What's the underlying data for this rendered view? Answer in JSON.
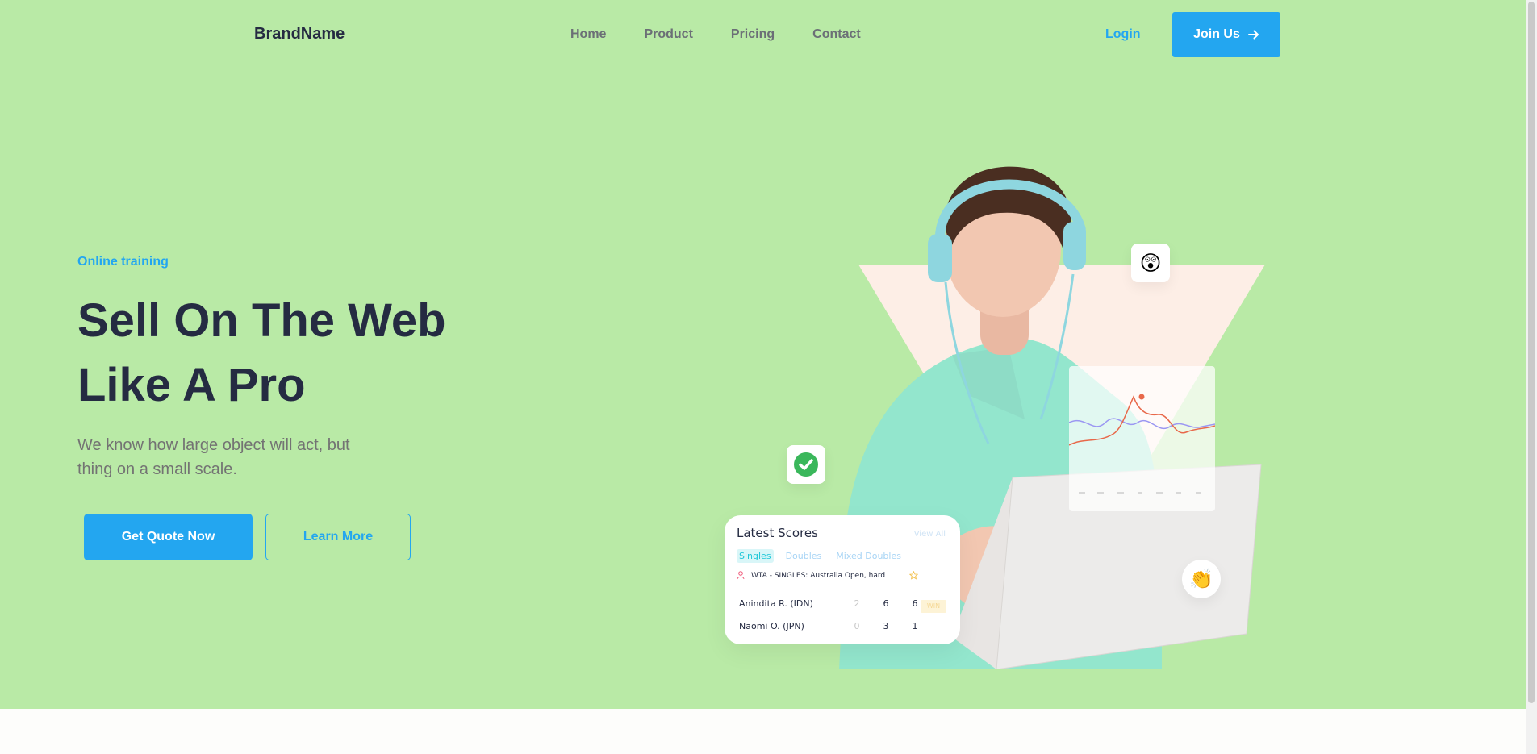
{
  "nav": {
    "brand": "BrandName",
    "links": [
      "Home",
      "Product",
      "Pricing",
      "Contact"
    ],
    "login": "Login",
    "join": "Join Us"
  },
  "hero": {
    "eyebrow": "Online training",
    "headline_line1": "Sell On The Web",
    "headline_line2": "Like A Pro",
    "subtext_line1": "We know how large object will act, but",
    "subtext_line2": "thing on a small scale.",
    "primary_button": "Get Quote Now",
    "secondary_button": "Learn More"
  },
  "scores_card": {
    "title": "Latest Scores",
    "view_all": "View All",
    "tabs": [
      "Singles",
      "Doubles",
      "Mixed Doubles"
    ],
    "event": "WTA - SINGLES: Australia Open, hard",
    "rows": [
      {
        "name": "Anindita R. (IDN)",
        "scores": [
          "2",
          "6",
          "6"
        ],
        "badge": "WIN"
      },
      {
        "name": "Naomi O. (JPN)",
        "scores": [
          "0",
          "3",
          "1"
        ]
      }
    ]
  },
  "colors": {
    "hero_bg": "#b9eaa6",
    "accent": "#23a6f0",
    "heading": "#252b42",
    "muted": "#737373"
  },
  "icons": {
    "emoji_shocked": "😲",
    "emoji_clap": "👏",
    "check": "check-circle-icon"
  }
}
